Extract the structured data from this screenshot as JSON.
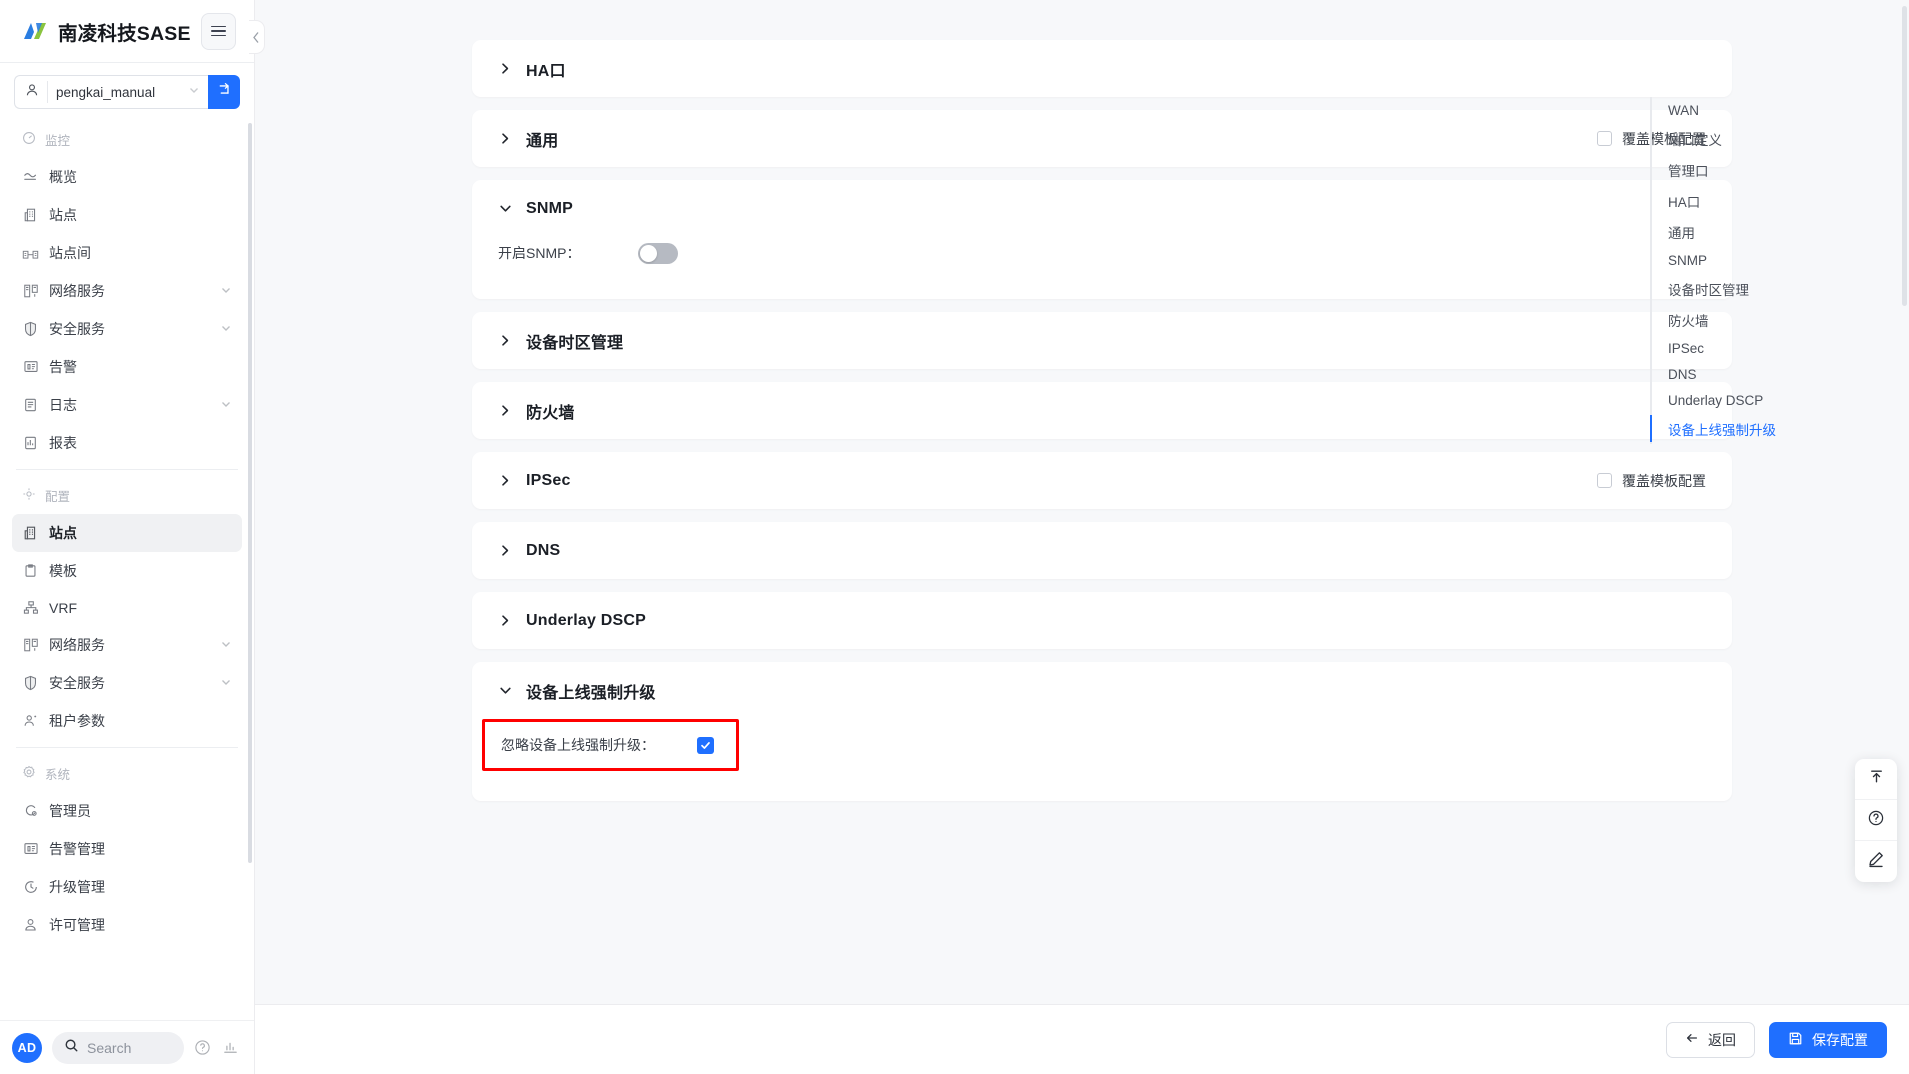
{
  "brand": {
    "title": "南凌科技SASE",
    "logo_colors": [
      "#2a7de1",
      "#8ac43f"
    ],
    "menu_icon": "hamburger-icon"
  },
  "tenant": {
    "value": "pengkai_manual",
    "person_icon": "person-icon",
    "caret_icon": "chevron-down-icon",
    "action_icon": "switch-tenant-icon",
    "accent": "#1f6fff"
  },
  "sidebar": {
    "groups": [
      {
        "label": "监控",
        "icon": "dashboard-icon",
        "items": [
          {
            "label": "概览",
            "icon": "overview-icon",
            "expandable": false,
            "active": false
          },
          {
            "label": "站点",
            "icon": "site-icon",
            "expandable": false,
            "active": false
          },
          {
            "label": "站点间",
            "icon": "site-to-site-icon",
            "expandable": false,
            "active": false
          },
          {
            "label": "网络服务",
            "icon": "network-service-icon",
            "expandable": true,
            "active": false
          },
          {
            "label": "安全服务",
            "icon": "shield-icon",
            "expandable": true,
            "active": false
          },
          {
            "label": "告警",
            "icon": "alarm-icon",
            "expandable": false,
            "active": false
          },
          {
            "label": "日志",
            "icon": "log-icon",
            "expandable": true,
            "active": false
          },
          {
            "label": "报表",
            "icon": "report-icon",
            "expandable": false,
            "active": false
          }
        ]
      },
      {
        "label": "配置",
        "icon": "config-icon",
        "items": [
          {
            "label": "站点",
            "icon": "site-icon",
            "expandable": false,
            "active": true
          },
          {
            "label": "模板",
            "icon": "template-icon",
            "expandable": false,
            "active": false
          },
          {
            "label": "VRF",
            "icon": "vrf-icon",
            "expandable": false,
            "active": false
          },
          {
            "label": "网络服务",
            "icon": "network-service-icon",
            "expandable": true,
            "active": false
          },
          {
            "label": "安全服务",
            "icon": "shield-icon",
            "expandable": true,
            "active": false
          },
          {
            "label": "租户参数",
            "icon": "tenant-param-icon",
            "expandable": false,
            "active": false
          }
        ]
      },
      {
        "label": "系统",
        "icon": "system-icon",
        "items": [
          {
            "label": "管理员",
            "icon": "admin-icon",
            "expandable": false,
            "active": false
          },
          {
            "label": "告警管理",
            "icon": "alarm-icon",
            "expandable": false,
            "active": false
          },
          {
            "label": "升级管理",
            "icon": "upgrade-icon",
            "expandable": false,
            "active": false
          },
          {
            "label": "许可管理",
            "icon": "license-icon",
            "expandable": false,
            "active": false
          }
        ]
      }
    ],
    "footer": {
      "avatar_initials": "AD",
      "search_placeholder": "Search",
      "search_icon": "search-icon",
      "help_icon": "help-circle-icon",
      "stats_icon": "chart-bar-icon"
    }
  },
  "main": {
    "sections": [
      {
        "id": "ha-port",
        "title": "HA口",
        "expanded": false,
        "override_checkbox": null
      },
      {
        "id": "general",
        "title": "通用",
        "expanded": false,
        "override_checkbox": {
          "label": "覆盖模板配置",
          "checked": false
        }
      },
      {
        "id": "snmp",
        "title": "SNMP",
        "expanded": true,
        "override_checkbox": null,
        "fields": [
          {
            "label": "开启SNMP：",
            "type": "switch",
            "value": false
          }
        ]
      },
      {
        "id": "device-timezone",
        "title": "设备时区管理",
        "expanded": false,
        "override_checkbox": null
      },
      {
        "id": "firewall",
        "title": "防火墙",
        "expanded": false,
        "override_checkbox": null
      },
      {
        "id": "ipsec",
        "title": "IPSec",
        "expanded": false,
        "override_checkbox": {
          "label": "覆盖模板配置",
          "checked": false
        }
      },
      {
        "id": "dns",
        "title": "DNS",
        "expanded": false,
        "override_checkbox": null
      },
      {
        "id": "underlay-dscp",
        "title": "Underlay DSCP",
        "expanded": false,
        "override_checkbox": null
      },
      {
        "id": "force-upgrade",
        "title": "设备上线强制升级",
        "expanded": true,
        "override_checkbox": null,
        "fields": [
          {
            "label": "忽略设备上线强制升级：",
            "type": "checkbox",
            "value": true,
            "highlighted": true
          }
        ]
      }
    ]
  },
  "anchor_nav": {
    "items": [
      {
        "label": "WAN",
        "active": false
      },
      {
        "label": "端口定义",
        "active": false
      },
      {
        "label": "管理口",
        "active": false
      },
      {
        "label": "HA口",
        "active": false
      },
      {
        "label": "通用",
        "active": false
      },
      {
        "label": "SNMP",
        "active": false
      },
      {
        "label": "设备时区管理",
        "active": false
      },
      {
        "label": "防火墙",
        "active": false
      },
      {
        "label": "IPSec",
        "active": false
      },
      {
        "label": "DNS",
        "active": false
      },
      {
        "label": "Underlay DSCP",
        "active": false
      },
      {
        "label": "设备上线强制升级",
        "active": true
      }
    ],
    "active_color": "#1f6fff"
  },
  "float_tools": [
    {
      "icon": "back-to-top-icon",
      "name": "back-to-top"
    },
    {
      "icon": "help-circle-icon",
      "name": "help"
    },
    {
      "icon": "pencil-icon",
      "name": "edit"
    }
  ],
  "bottom_bar": {
    "back_label": "返回",
    "back_icon": "arrow-left-icon",
    "save_label": "保存配置",
    "save_icon": "save-icon",
    "watermark": ""
  },
  "colors": {
    "accent": "#1f6fff",
    "highlight": "#ff0000",
    "page_bg": "#f7f8fa",
    "card_bg": "#ffffff"
  }
}
